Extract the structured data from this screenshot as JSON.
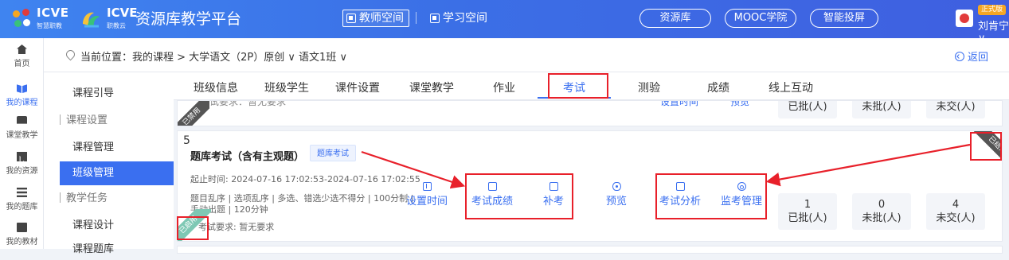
{
  "topbar": {
    "logo1_text": "ICVE",
    "logo1_sub": "智慧职教",
    "logo2_text": "ICVE",
    "logo2_sub": "职教云",
    "platform_title": "资源库教学平台",
    "teacher_space": "教师空间",
    "student_space": "学习空间",
    "pills": [
      "资源库",
      "MOOC学院",
      "智能投屏"
    ],
    "badge": "正式版",
    "username": "刘肯宁 ∨"
  },
  "rail": {
    "items": [
      "首页",
      "我的课程",
      "课堂教学",
      "我的资源",
      "我的题库",
      "我的教材"
    ]
  },
  "breadcrumb": {
    "text": "当前位置：我的课程 > 大学语文（2P）原创 ∨  语文1班 ∨",
    "back": "返回"
  },
  "side_menu": {
    "items": [
      "课程引导",
      "课程设置",
      "课程管理",
      "班级管理",
      "教学任务",
      "课程设计",
      "课程题库"
    ]
  },
  "tabs": [
    "班级信息",
    "班级学生",
    "课件设置",
    "课堂教学",
    "作业",
    "考试",
    "测验",
    "成绩",
    "线上互动"
  ],
  "prev_card": {
    "requirement": "考试要求：暂无要求",
    "action_time": "设置时间",
    "action_preview": "预览",
    "stats": [
      "已批(人)",
      "未批(人)",
      "未交(人)"
    ],
    "ribbon": "已禁用"
  },
  "exam_card": {
    "index": "5",
    "title": "题库考试（含有主观题）",
    "tag": "题库考试",
    "start_time": "起止时间: 2024-07-16 17:02:53-2024-07-16 17:02:55",
    "settings_line1": "题目乱序 | 选项乱序 | 多选、错选少选不得分 | 100分制 |",
    "settings_line2": "手动出题 | 120分钟",
    "requirement": "考试要求: 暂无要求",
    "actions": [
      "设置时间",
      "考试成绩",
      "补考",
      "预览",
      "考试分析",
      "监考管理"
    ],
    "stats": [
      {
        "value": "1",
        "label": "已批(人)"
      },
      {
        "value": "0",
        "label": "未批(人)"
      },
      {
        "value": "4",
        "label": "未交(人)"
      }
    ],
    "ribbon_left": "已启用",
    "ribbon_right": "已结束"
  },
  "colors": {
    "accent": "#3a6ff0",
    "annotation": "#e8202a",
    "enabled_ribbon": "#7ec8b4",
    "ended_ribbon": "#555555"
  }
}
